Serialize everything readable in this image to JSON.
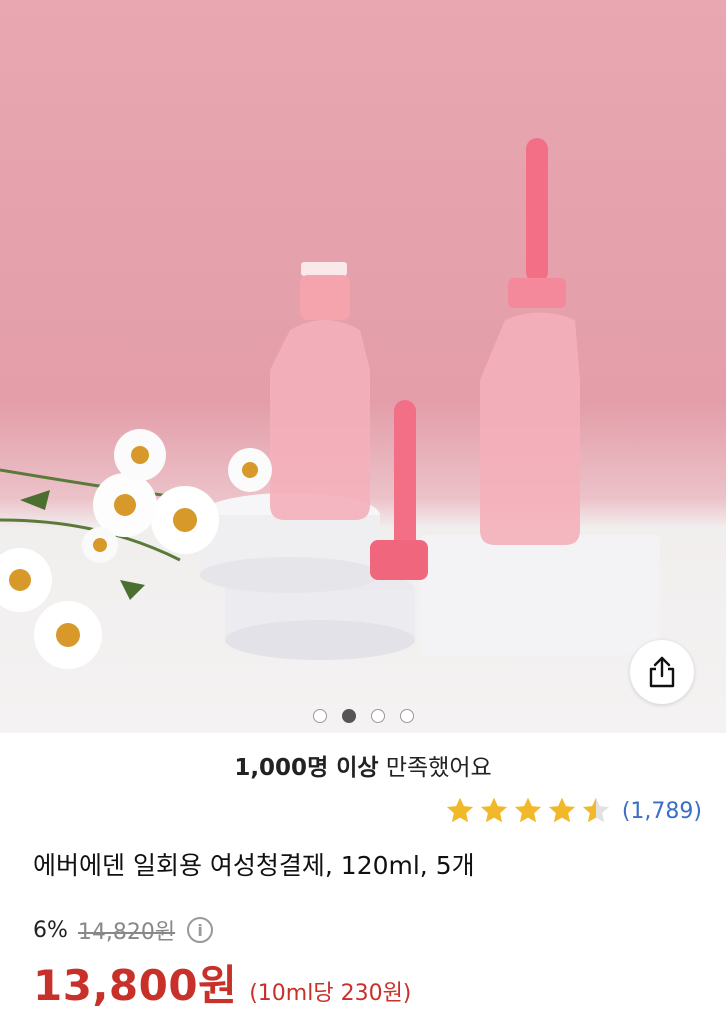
{
  "hero": {
    "image_alt": "Pink disposable bottles with flowers",
    "carousel_dots": 4,
    "active_dot": 1
  },
  "share": {
    "icon": "share-icon"
  },
  "satisfaction": {
    "bold": "1,000명 이상",
    "rest": "만족했어요"
  },
  "rating": {
    "stars": 4.5,
    "count": "(1,789)",
    "star_color": "#f1b92a"
  },
  "product": {
    "title": "에버에덴 일회용 여성청결제, 120ml, 5개"
  },
  "price": {
    "discount": "6%",
    "original": "14,820원",
    "sale": "13,800원",
    "unit_price": "(10ml당 230원)",
    "sale_color": "#c8302a"
  }
}
